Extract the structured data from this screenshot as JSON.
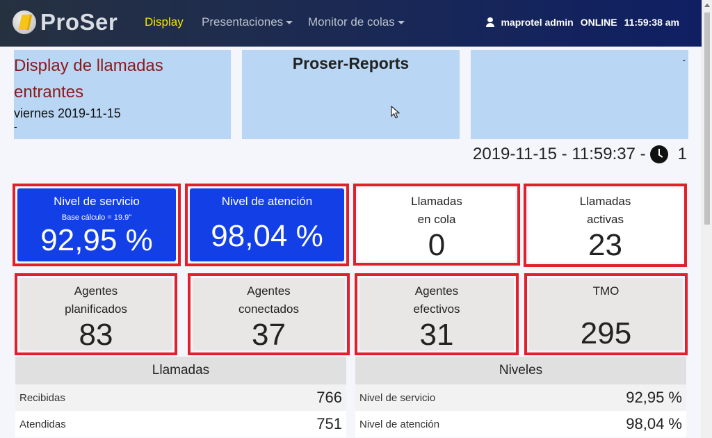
{
  "navbar": {
    "brand": "ProSer",
    "items": [
      {
        "label": "Display"
      },
      {
        "label": "Presentaciones"
      },
      {
        "label": "Monitor de colas"
      }
    ],
    "user": "maprotel admin",
    "status": "ONLINE",
    "time": "11:59:38 am"
  },
  "header": {
    "panel1": {
      "title": "Display de llamadas entrantes",
      "date": "viernes 2019-11-15",
      "dash": "-"
    },
    "panel2": {
      "title": "Proser-Reports"
    },
    "panel3": {
      "dash": "-"
    }
  },
  "timestamp": {
    "text": "2019-11-15 - 11:59:37 -",
    "counter": "1"
  },
  "kpis": [
    {
      "label1": "Nivel de servicio",
      "label2": "",
      "sub": "Base cálculo = 19.9\"",
      "value": "92,95 %"
    },
    {
      "label1": "Nivel de atención",
      "label2": "",
      "sub": "",
      "value": "98,04 %"
    },
    {
      "label1": "Llamadas",
      "label2": "en cola",
      "sub": "",
      "value": "0"
    },
    {
      "label1": "Llamadas",
      "label2": "activas",
      "sub": "",
      "value": "23"
    },
    {
      "label1": "Agentes",
      "label2": "planificados",
      "sub": "",
      "value": "83"
    },
    {
      "label1": "Agentes",
      "label2": "conectados",
      "sub": "",
      "value": "37"
    },
    {
      "label1": "Agentes",
      "label2": "efectivos",
      "sub": "",
      "value": "31"
    },
    {
      "label1": "TMO",
      "label2": "",
      "sub": "",
      "value": "295"
    }
  ],
  "tables": {
    "llamadas": {
      "title": "Llamadas",
      "rows": [
        {
          "label": "Recibidas",
          "value": "766"
        },
        {
          "label": "Atendidas",
          "value": "751"
        }
      ]
    },
    "niveles": {
      "title": "Niveles",
      "rows": [
        {
          "label": "Nivel de servicio",
          "value": "92,95 %"
        },
        {
          "label": "Nivel de atención",
          "value": "98,04 %"
        }
      ]
    }
  },
  "colors": {
    "accent_blue": "#1240e6",
    "alert_red": "#e0202a",
    "panel_blue": "#b9d7f4",
    "title_red": "#8b1a1a",
    "nav_active": "#f5e400"
  }
}
